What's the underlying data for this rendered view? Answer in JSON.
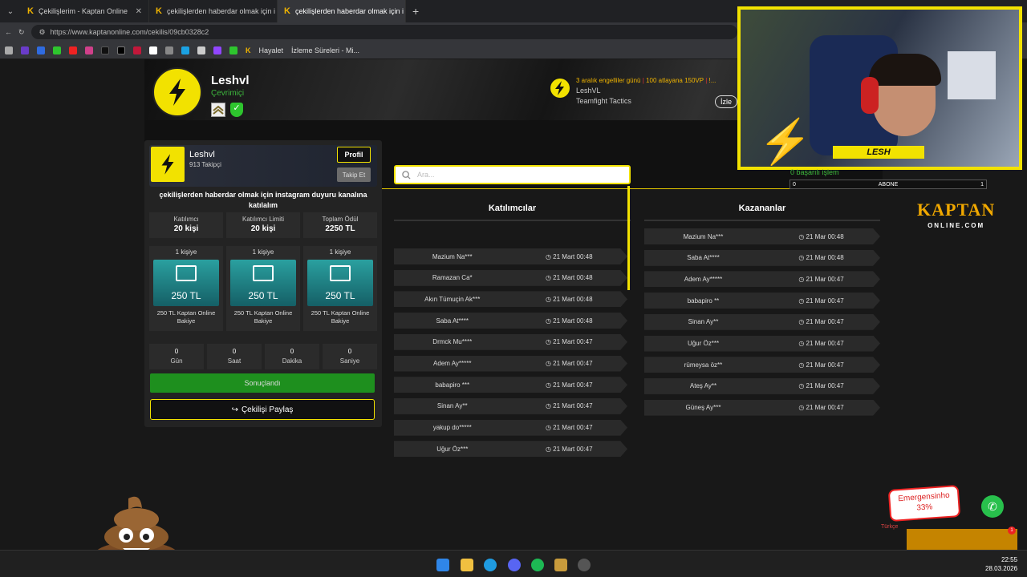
{
  "browser": {
    "tabs": [
      {
        "label": "Çekilişlerim - Kaptan Online",
        "active": false
      },
      {
        "label": "çekilişlerden haberdar olmak için i",
        "active": false
      },
      {
        "label": "çekilişlerden haberdar olmak için i",
        "active": true
      }
    ],
    "url": "https://www.kaptanonline.com/cekilis/09cb0328c2",
    "bookmarks": [
      "Hayalet",
      "İzleme Süreleri - Mi..."
    ]
  },
  "profile": {
    "name": "Leshvl",
    "status": "Çevrimiçi"
  },
  "live": {
    "title_a": "3 aralık engelliler günü",
    "sep": "|",
    "title_b": "100 atlayana 150VP",
    "title_c": "!...",
    "channel": "LeshVL",
    "game": "Teamfight Tactics",
    "watch_label": "İzle"
  },
  "card": {
    "name": "Leshvl",
    "followers": "913 Takipçi",
    "profile_btn": "Profil",
    "follow_btn": "Takip Et",
    "title": "çekilişlerden haberdar olmak için instagram duyuru kanalına katılalım",
    "stats": [
      {
        "label": "Katılımcı",
        "value": "20 kişi"
      },
      {
        "label": "Katılımcı Limiti",
        "value": "20 kişi"
      },
      {
        "label": "Toplam Ödül",
        "value": "2250 TL"
      }
    ],
    "prizes": [
      {
        "count": "1 kişiye",
        "amount": "250 TL",
        "desc": "250 TL Kaptan Online Bakiye"
      },
      {
        "count": "1 kişiye",
        "amount": "250 TL",
        "desc": "250 TL Kaptan Online Bakiye"
      },
      {
        "count": "1 kişiye",
        "amount": "250 TL",
        "desc": "250 TL Kaptan Online Bakiye"
      }
    ],
    "timer": [
      {
        "value": "0",
        "label": "Gün"
      },
      {
        "value": "0",
        "label": "Saat"
      },
      {
        "value": "0",
        "label": "Dakika"
      },
      {
        "value": "0",
        "label": "Saniye"
      }
    ],
    "result_btn": "Sonuçlandı",
    "share_btn": "Çekilişi Paylaş"
  },
  "participants": {
    "header": "Katılımcılar",
    "search_placeholder": "Ara...",
    "rows": [
      {
        "name": "Mazium Na***",
        "time": "21 Mart 00:48"
      },
      {
        "name": "Ramazan Ca*",
        "time": "21 Mart 00:48"
      },
      {
        "name": "Akın Tümuçin Ak***",
        "time": "21 Mart 00:48"
      },
      {
        "name": "Saba At****",
        "time": "21 Mart 00:48"
      },
      {
        "name": "Drmck Mu****",
        "time": "21 Mart 00:47"
      },
      {
        "name": "Adem Ay*****",
        "time": "21 Mart 00:47"
      },
      {
        "name": "babapiro ***",
        "time": "21 Mart 00:47"
      },
      {
        "name": "Sinan Ay**",
        "time": "21 Mart 00:47"
      },
      {
        "name": "yakup do*****",
        "time": "21 Mart 00:47"
      },
      {
        "name": "Uğur Öz***",
        "time": "21 Mart 00:47"
      }
    ]
  },
  "winners": {
    "header": "Kazananlar",
    "rows": [
      {
        "name": "Mazium Na***",
        "time": "21 Mar 00:48"
      },
      {
        "name": "Saba At****",
        "time": "21 Mar 00:48"
      },
      {
        "name": "Adem Ay*****",
        "time": "21 Mar 00:47"
      },
      {
        "name": "babapiro **",
        "time": "21 Mar 00:47"
      },
      {
        "name": "Sinan Ay**",
        "time": "21 Mar 00:47"
      },
      {
        "name": "Uğur Öz***",
        "time": "21 Mar 00:47"
      },
      {
        "name": "rümeysa öz**",
        "time": "21 Mar 00:47"
      },
      {
        "name": "Ateş Ay**",
        "time": "21 Mar 00:47"
      },
      {
        "name": "Güneş Ay***",
        "time": "21 Mar 00:47"
      }
    ]
  },
  "logo": {
    "main": "KAPTAN",
    "sub": "ONLINE.COM"
  },
  "stream": {
    "streamer_tag": "LESH",
    "success_text": "0 başarılı işlem",
    "sub_left": "0",
    "sub_label": "ABONE",
    "sub_right": "1",
    "alert_name": "Emergensinho",
    "alert_pct": "33%",
    "lang": "Türkçe",
    "notif_count": "1"
  },
  "taskbar": {
    "time": "22:55",
    "date": "28.03.2026"
  },
  "colors": {
    "accent": "#f2e200",
    "online": "#3db83d",
    "result": "#1e8f1e"
  }
}
